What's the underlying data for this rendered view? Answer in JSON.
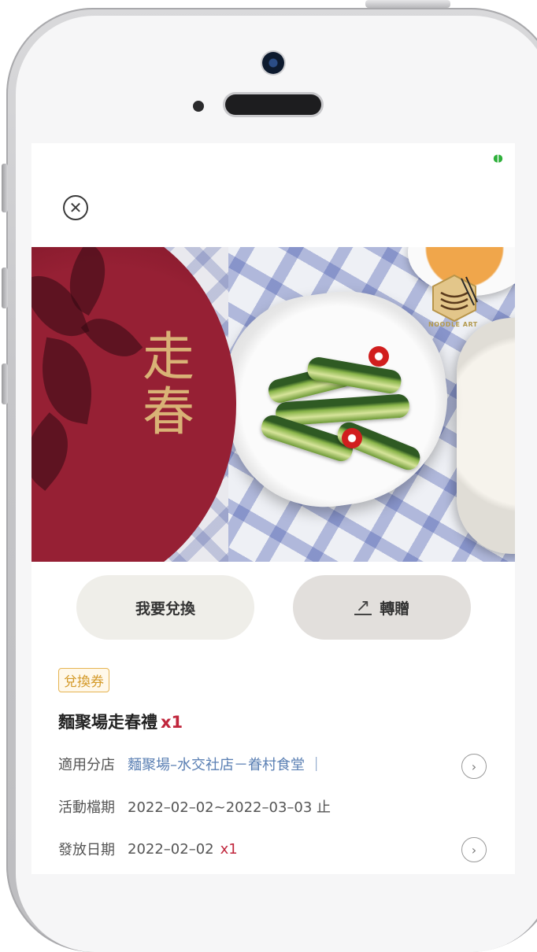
{
  "status": {
    "battery_glyph": "◖◗"
  },
  "close": {
    "glyph": "✕"
  },
  "banner": {
    "title": "走春",
    "logo_text": "NOODLE ART"
  },
  "actions": {
    "redeem_label": "我要兌換",
    "gift_label": "轉贈",
    "share_glyph": "↗"
  },
  "coupon": {
    "tag": "兌換券",
    "name": "麵聚場走春禮",
    "qty": "x1",
    "rows": [
      {
        "label": "適用分店",
        "value": "麵聚場–水交社店－眷村食堂 ｜"
      },
      {
        "label": "活動檔期",
        "value": "2022–02–02~2022–03–03 止"
      },
      {
        "label": "發放日期",
        "value": "2022–02–02",
        "extra": "x1"
      }
    ]
  },
  "icons": {
    "chevron": "›"
  },
  "colors": {
    "accent_red": "#c0263c",
    "tag_gold": "#d49a2a",
    "link_blue": "#5a7fb3",
    "banner_red": "#962034"
  }
}
